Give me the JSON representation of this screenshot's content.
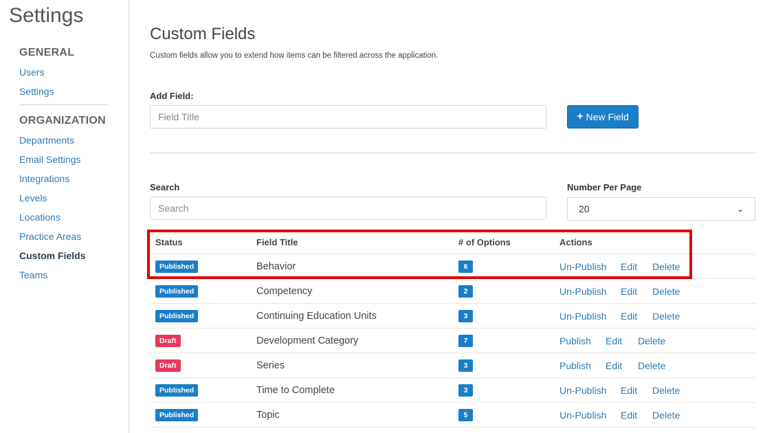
{
  "sidebar": {
    "title": "Settings",
    "sections": [
      {
        "heading": "GENERAL",
        "items": [
          "Users",
          "Settings"
        ]
      },
      {
        "heading": "ORGANIZATION",
        "items": [
          "Departments",
          "Email Settings",
          "Integrations",
          "Levels",
          "Locations",
          "Practice Areas",
          "Custom Fields",
          "Teams"
        ]
      }
    ],
    "active_item": "Custom Fields"
  },
  "main": {
    "title": "Custom Fields",
    "description": "Custom fields allow you to extend how items can be filtered across the application.",
    "add_field": {
      "label": "Add Field:",
      "placeholder": "Field Title",
      "button_label": "New Field",
      "button_icon": "plus-icon"
    },
    "search": {
      "label": "Search",
      "placeholder": "Search"
    },
    "per_page": {
      "label": "Number Per Page",
      "selected": "20"
    },
    "table": {
      "headers": [
        "Status",
        "Field Title",
        "# of Options",
        "Actions"
      ],
      "rows": [
        {
          "status": "Published",
          "title": "Behavior",
          "options": "6",
          "actions": [
            "Un-Publish",
            "Edit",
            "Delete"
          ]
        },
        {
          "status": "Published",
          "title": "Competency",
          "options": "2",
          "actions": [
            "Un-Publish",
            "Edit",
            "Delete"
          ]
        },
        {
          "status": "Published",
          "title": "Continuing Education Units",
          "options": "3",
          "actions": [
            "Un-Publish",
            "Edit",
            "Delete"
          ]
        },
        {
          "status": "Draft",
          "title": "Development Category",
          "options": "7",
          "actions": [
            "Publish",
            "Edit",
            "Delete"
          ]
        },
        {
          "status": "Draft",
          "title": "Series",
          "options": "3",
          "actions": [
            "Publish",
            "Edit",
            "Delete"
          ]
        },
        {
          "status": "Published",
          "title": "Time to Complete",
          "options": "3",
          "actions": [
            "Un-Publish",
            "Edit",
            "Delete"
          ]
        },
        {
          "status": "Published",
          "title": "Topic",
          "options": "5",
          "actions": [
            "Un-Publish",
            "Edit",
            "Delete"
          ]
        }
      ]
    }
  },
  "colors": {
    "primary": "#1a7ec8",
    "draft": "#e8385d",
    "link": "#2c7bb6",
    "highlight": "#e30000"
  }
}
